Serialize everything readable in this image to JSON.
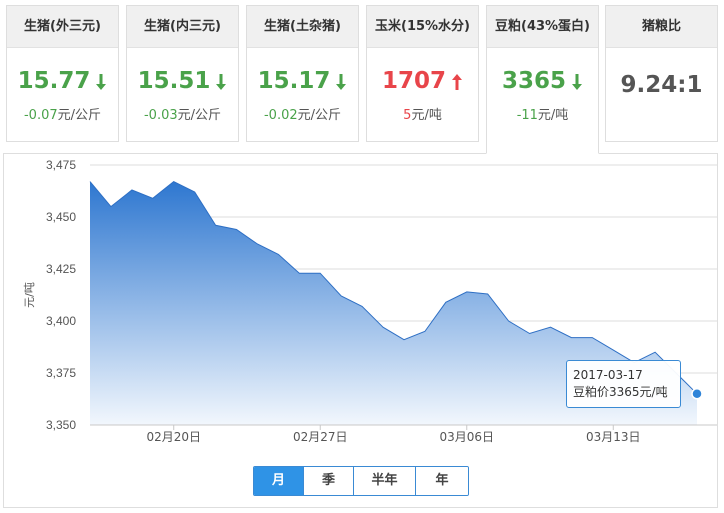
{
  "cards": [
    {
      "title": "生猪(外三元)",
      "value": "15.77",
      "direction": "down",
      "change": "-0.07",
      "unit": "元/公斤"
    },
    {
      "title": "生猪(内三元)",
      "value": "15.51",
      "direction": "down",
      "change": "-0.03",
      "unit": "元/公斤"
    },
    {
      "title": "生猪(土杂猪)",
      "value": "15.17",
      "direction": "down",
      "change": "-0.02",
      "unit": "元/公斤"
    },
    {
      "title": "玉米(15%水分)",
      "value": "1707",
      "direction": "up",
      "change": "5",
      "unit": "元/吨"
    },
    {
      "title": "豆粕(43%蛋白)",
      "value": "3365",
      "direction": "down",
      "change": "-11",
      "unit": "元/吨"
    },
    {
      "title": "猪粮比",
      "value": "9.24:1",
      "direction": "none",
      "change": "",
      "unit": ""
    }
  ],
  "colors": {
    "down": "#4aa24a",
    "up": "#e8454a",
    "accent": "#2f93e6",
    "area_top": "#2e77d0",
    "area_bottom": "#f2f7fd"
  },
  "tabs": [
    {
      "label": "月",
      "active": true
    },
    {
      "label": "季",
      "active": false
    },
    {
      "label": "半年",
      "active": false
    },
    {
      "label": "年",
      "active": false
    }
  ],
  "tooltip": {
    "date": "2017-03-17",
    "label": "豆粕价3365元/吨"
  },
  "chart_data": {
    "type": "area",
    "ylabel": "元/吨",
    "ylim": [
      3350,
      3475
    ],
    "yticks": [
      3350,
      3375,
      3400,
      3425,
      3450,
      3475
    ],
    "ytick_labels": [
      "3,350",
      "3,375",
      "3,400",
      "3,425",
      "3,450",
      "3,475"
    ],
    "x_start": "2017-02-16",
    "x_end": "2017-03-17",
    "xticks": [
      "2017-02-20",
      "2017-02-27",
      "2017-03-06",
      "2017-03-13"
    ],
    "xtick_labels": [
      "02月20日",
      "02月27日",
      "03月06日",
      "03月13日"
    ],
    "x": [
      "2017-02-16",
      "2017-02-17",
      "2017-02-18",
      "2017-02-19",
      "2017-02-20",
      "2017-02-21",
      "2017-02-22",
      "2017-02-23",
      "2017-02-24",
      "2017-02-25",
      "2017-02-26",
      "2017-02-27",
      "2017-02-28",
      "2017-03-01",
      "2017-03-02",
      "2017-03-03",
      "2017-03-04",
      "2017-03-05",
      "2017-03-06",
      "2017-03-07",
      "2017-03-08",
      "2017-03-09",
      "2017-03-10",
      "2017-03-11",
      "2017-03-12",
      "2017-03-13",
      "2017-03-14",
      "2017-03-15",
      "2017-03-16",
      "2017-03-17"
    ],
    "series": [
      {
        "name": "豆粕价",
        "values": [
          3467,
          3455,
          3463,
          3459,
          3467,
          3462,
          3446,
          3444,
          3437,
          3432,
          3423,
          3423,
          3412,
          3407,
          3397,
          3391,
          3395,
          3409,
          3414,
          3413,
          3400,
          3394,
          3397,
          3392,
          3392,
          3386,
          3380,
          3385,
          3375,
          3365
        ]
      }
    ],
    "grid": true,
    "highlight_point": "2017-03-17"
  }
}
